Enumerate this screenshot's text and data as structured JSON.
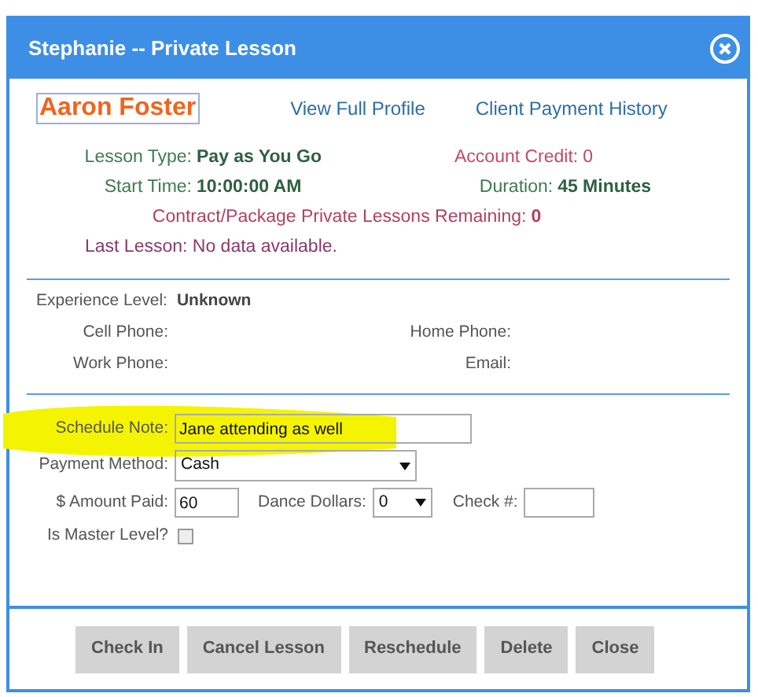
{
  "window": {
    "title": "Stephanie -- Private Lesson"
  },
  "client": {
    "name": "Aaron Foster",
    "links": [
      "View Full Profile",
      "Client Payment History"
    ]
  },
  "lesson": {
    "lesson_type": {
      "label": "Lesson Type:",
      "value": "Pay as You Go"
    },
    "account_credit": {
      "label": "Account Credit:",
      "value": "0"
    },
    "start_time": {
      "label": "Start Time:",
      "value": "10:00:00 AM"
    },
    "duration": {
      "label": "Duration:",
      "value": "45 Minutes"
    },
    "remaining": {
      "label": "Contract/Package Private Lessons Remaining:",
      "value": "0"
    },
    "last_lesson": "Last Lesson: No data available."
  },
  "contact": {
    "experience_level": {
      "label": "Experience Level:",
      "value": "Unknown"
    },
    "cell_phone": "Cell Phone:",
    "home_phone": "Home Phone:",
    "work_phone": "Work Phone:",
    "email": "Email:"
  },
  "form": {
    "schedule_note": {
      "label": "Schedule Note:",
      "value": "Jane attending as well"
    },
    "payment_method": {
      "label": "Payment Method:",
      "value": "Cash"
    },
    "amount_paid": {
      "label": "$ Amount Paid:",
      "value": "60"
    },
    "dance_dollars": {
      "label": "Dance Dollars:",
      "value": "0"
    },
    "check_number": {
      "label": "Check #:"
    },
    "master_level": {
      "label": "Is Master Level?",
      "checked": false
    }
  },
  "buttons": [
    "Check In",
    "Cancel Lesson",
    "Reschedule",
    "Delete",
    "Close"
  ]
}
